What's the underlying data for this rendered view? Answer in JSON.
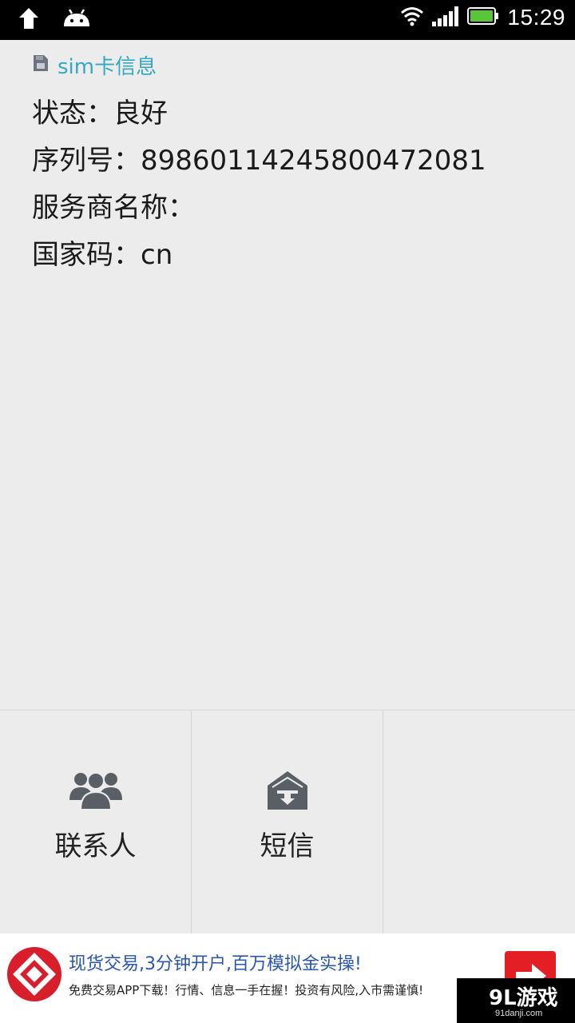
{
  "status_bar": {
    "time": "15:29",
    "icons": [
      "upload-arrow-icon",
      "android-icon",
      "wifi-icon",
      "signal-icon",
      "battery-icon"
    ]
  },
  "section": {
    "title": "sim卡信息",
    "icon": "sim-card-icon"
  },
  "info": {
    "status": "状态：良好",
    "serial": "序列号：89860114245800472081",
    "operator": "服务商名称：",
    "country": "国家码：cn"
  },
  "tabs": [
    {
      "label": "联系人",
      "icon": "contacts-icon"
    },
    {
      "label": "短信",
      "icon": "sms-icon"
    },
    {
      "label": "",
      "icon": ""
    }
  ],
  "ad": {
    "title": "现货交易,3分钟开户,百万模拟金实操!",
    "subtitle": "免费交易APP下载！行情、信息一手在握！投资有风险,入市需谨慎!",
    "button_icon": "arrow-right-icon"
  },
  "watermark": {
    "main": "9L游戏",
    "sub": "91danji.com"
  },
  "colors": {
    "accent": "#33a9c2",
    "background": "#ececec",
    "ad_title": "#2a55b0",
    "ad_button": "#e31e24"
  }
}
